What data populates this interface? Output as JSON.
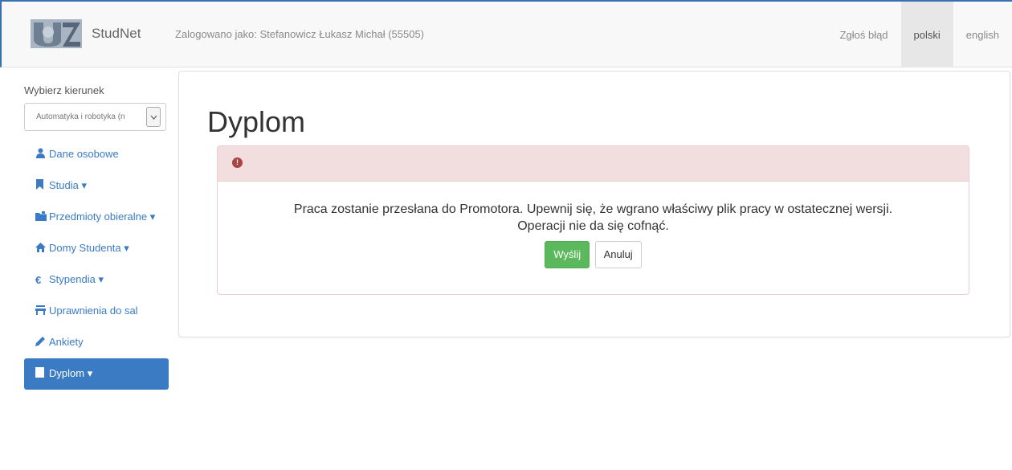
{
  "header": {
    "brand": "StudNet",
    "logged_in": "Zalogowano jako: Stefanowicz Łukasz Michał (55505)",
    "links": [
      {
        "label": "Zgłoś błąd",
        "active": false
      },
      {
        "label": "polski",
        "active": true
      },
      {
        "label": "english",
        "active": false
      }
    ]
  },
  "sidebar": {
    "select_label": "Wybierz kierunek",
    "select_value": "Automatyka i robotyka (n",
    "items": [
      {
        "label": "Dane osobowe",
        "icon": "user-icon"
      },
      {
        "label": "Studia",
        "icon": "bookmark-icon",
        "caret": true
      },
      {
        "label": "Przedmioty obieralne",
        "icon": "folder-icon",
        "caret": true
      },
      {
        "label": "Domy Studenta",
        "icon": "home-icon",
        "caret": true
      },
      {
        "label": "Stypendia",
        "icon": "euro-icon",
        "caret": true
      },
      {
        "label": "Uprawnienia do sal",
        "icon": "chair-icon"
      },
      {
        "label": "Ankiety",
        "icon": "pencil-icon"
      },
      {
        "label": "Dyplom",
        "icon": "file-icon",
        "caret": true,
        "active": true
      }
    ]
  },
  "main": {
    "title": "Dyplom",
    "alert_line1": "Praca zostanie przesłana do Promotora. Upewnij się, że wgrano właściwy plik pracy w ostatecznej wersji.",
    "alert_line2": "Operacji nie da się cofnąć.",
    "send_label": "Wyślij",
    "cancel_label": "Anuluj"
  },
  "colors": {
    "accent": "#3a7bc4",
    "success": "#5cb85c",
    "danger_bg": "#f2dede",
    "danger_icon": "#a94442"
  }
}
